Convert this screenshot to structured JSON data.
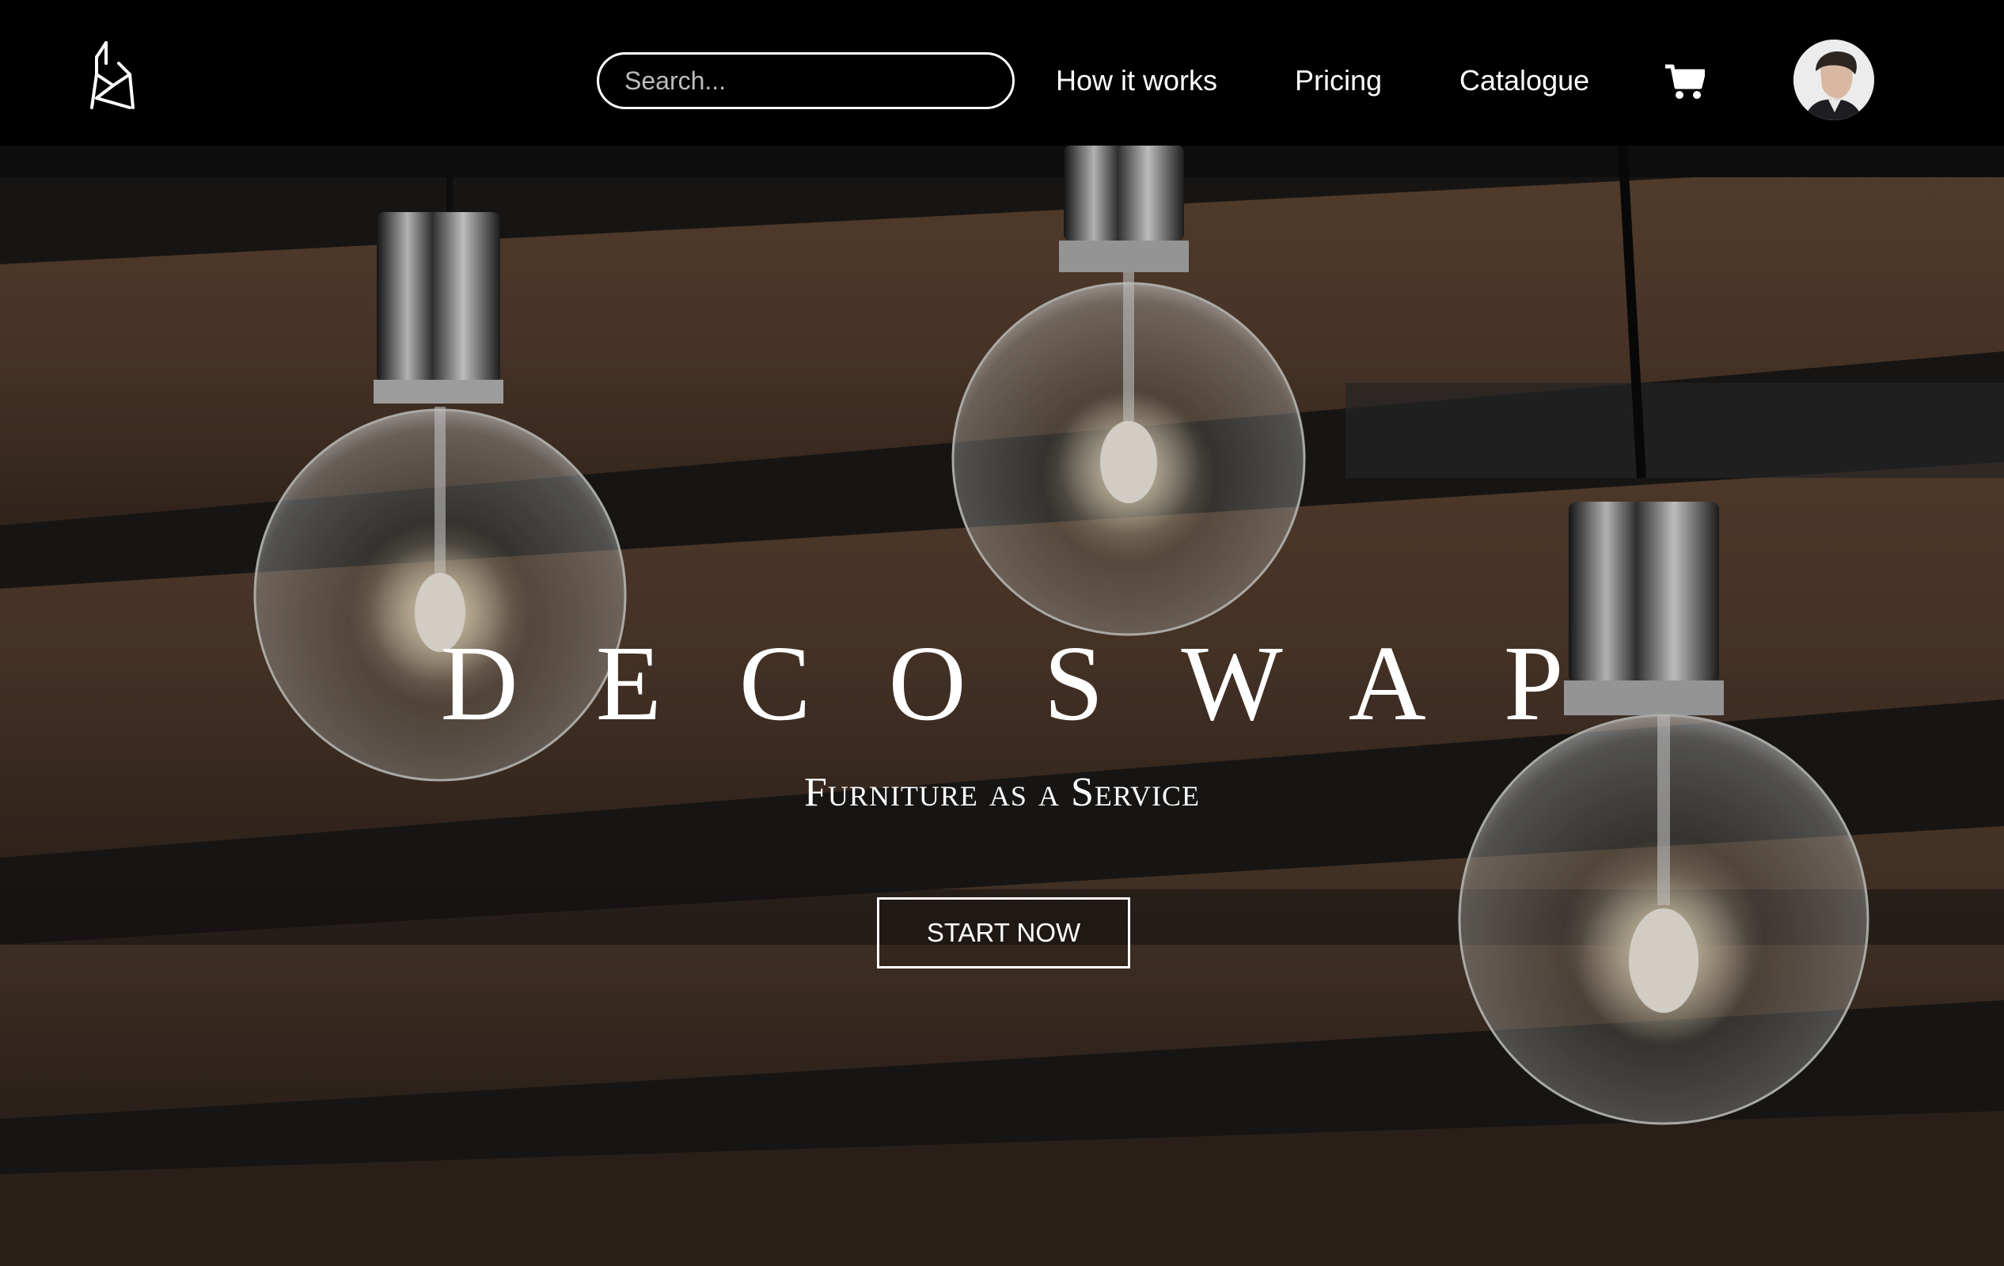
{
  "nav": {
    "logo_icon": "decoswap-logo-icon",
    "search": {
      "placeholder": "Search...",
      "value": ""
    },
    "links": [
      {
        "label": "How it works"
      },
      {
        "label": "Pricing"
      },
      {
        "label": "Catalogue"
      }
    ],
    "cart_icon": "shopping-cart-icon",
    "avatar_icon": "user-avatar"
  },
  "hero": {
    "brand": "DECOSWAP",
    "tagline": "Furniture as a Service",
    "cta_label": "START NOW"
  },
  "colors": {
    "nav_background": "#000000",
    "text": "#ffffff",
    "hero_wood": "#5a4130"
  }
}
